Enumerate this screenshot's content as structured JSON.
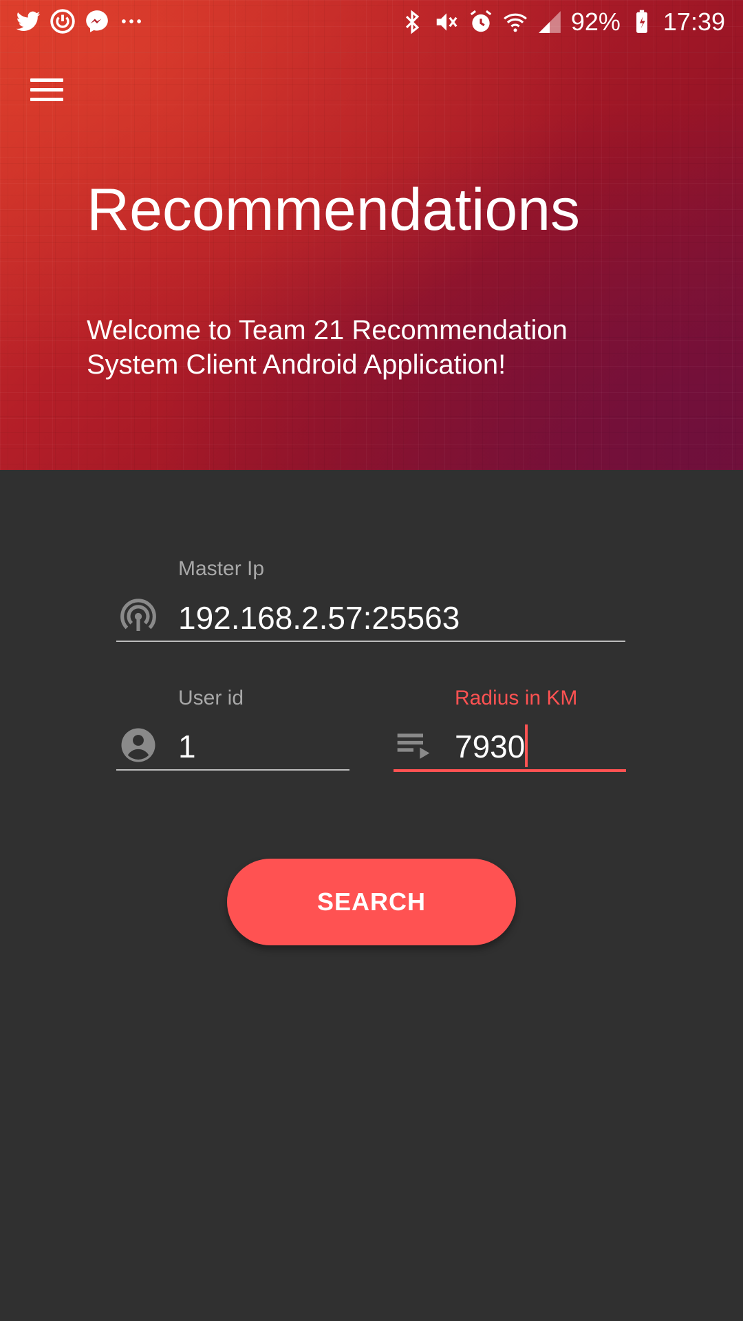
{
  "status_bar": {
    "battery": "92%",
    "time": "17:39",
    "left_icons": [
      "twitter-icon",
      "power-app-icon",
      "messenger-icon",
      "more-dots-icon"
    ],
    "right_icons": [
      "bluetooth-icon",
      "mute-icon",
      "alarm-icon",
      "wifi-icon",
      "signal-icon",
      "battery-charging-icon"
    ]
  },
  "header": {
    "title": "Recommendations",
    "welcome": "Welcome to Team 21 Recommendation System Client Android Application!"
  },
  "form": {
    "master_ip": {
      "label": "Master Ip",
      "value": "192.168.2.57:25563",
      "icon": "broadcast-icon"
    },
    "user_id": {
      "label": "User id",
      "value": "1",
      "icon": "account-circle-icon"
    },
    "radius": {
      "label": "Radius in KM",
      "value": "7930",
      "icon": "playlist-play-icon"
    },
    "search_label": "SEARCH"
  },
  "colors": {
    "accent": "#ff5252",
    "background": "#303030",
    "header_start": "#d8392b",
    "header_end": "#7a1238"
  }
}
